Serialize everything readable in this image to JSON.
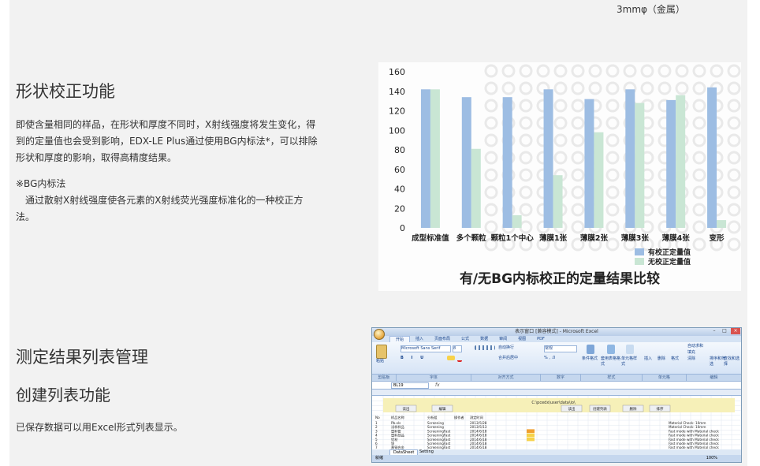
{
  "top_note": "3mmφ（金属）",
  "section1": {
    "heading": "形状校正功能",
    "para_lines": [
      "即使含量相同的样品，在形状和厚度不同时，X射线强度将发生变化，得",
      "到的定量值也会受到影响，EDX-LE Plus通过使用BG内标法*，可以排除",
      "形状和厚度的影响，取得高精度结果。"
    ],
    "note_title": "※BG内标法",
    "note_lines": [
      "　通过散射X射线强度使各元素的X射线荧光强度标准化的一种校正方",
      "法。"
    ]
  },
  "section2": {
    "heading": "测定结果列表管理",
    "subheading": "创建列表功能",
    "para": "已保存数据可以用Excel形式列表显示。"
  },
  "chart_data": {
    "type": "bar",
    "title": "有/无BG内标校正的定量结果比较",
    "categories": [
      "成型标准值",
      "多个颗粒",
      "颗粒1个中心",
      "薄膜1张",
      "薄膜2张",
      "薄膜3张",
      "薄膜4张",
      "变形"
    ],
    "series": [
      {
        "name": "有校正定量值",
        "color": "#9dbde3",
        "values": [
          142,
          134,
          134,
          142,
          132,
          142,
          131,
          144
        ]
      },
      {
        "name": "无校正定量值",
        "color": "#c9e6d4",
        "values": [
          142,
          81,
          13,
          54,
          98,
          128,
          136,
          8
        ]
      }
    ],
    "ylim": [
      0,
      160
    ],
    "yticks": [
      0,
      20,
      40,
      60,
      80,
      100,
      120,
      140,
      160
    ],
    "legend": "bottom-right",
    "grid": false
  },
  "excel": {
    "title": "表示窗口 [兼容模式] - Microsoft Excel",
    "tabs": [
      "开始",
      "插入",
      "页面布局",
      "公式",
      "数据",
      "审阅",
      "视图",
      "PDF"
    ],
    "ribbon": {
      "paste": "粘贴",
      "font_name": "Microsoft Sans Serif",
      "font_size": "8",
      "wrap": "自动换行",
      "merge": "合并后居中",
      "number_format": "常规",
      "cond_format": "条件格式",
      "table_format": "套用表格格式",
      "cell_style": "单元格样式",
      "insert": "插入",
      "delete": "删除",
      "format": "格式",
      "autosum": "自动求和",
      "fill": "填充",
      "clear": "清除",
      "sort_filter": "排序和筛选",
      "find_select": "查找和选择"
    },
    "groups": [
      "剪贴板",
      "字体",
      "对齐方式",
      "数字",
      "样式",
      "单元格",
      "编辑"
    ],
    "name_box": "BL19",
    "fx": "fx",
    "path": "C:\\pcedx\\user\\data\\io\\",
    "buttons": [
      "读出",
      "编辑",
      "读出",
      "创建列表",
      "删除",
      "排序"
    ],
    "header_row": [
      "No",
      "样品名称",
      "分析组",
      "操作者",
      "测定时间"
    ],
    "rows": [
      [
        "1",
        "Pb.xls",
        "Screening",
        "",
        "2013/5/28"
      ],
      [
        "2",
        "试样样品",
        "Screening",
        "",
        "2013/5/13"
      ],
      [
        "3",
        "塑料管",
        "ScreeningFast",
        "",
        "2014/6/18"
      ],
      [
        "4",
        "塑料部品",
        "ScreeningFast",
        "",
        "2014/6/18"
      ],
      [
        "5",
        "铝材",
        "ScreeningFast",
        "",
        "2014/6/18"
      ],
      [
        "6",
        "锌",
        "ScreeningFast",
        "",
        "2014/6/18"
      ],
      [
        "7",
        "黄铜合金",
        "ScreeningFast",
        "",
        "2014/6/18"
      ],
      [
        "8",
        "黄铜箔",
        "ScreeningFast",
        "",
        "2014/6/18"
      ]
    ],
    "remarks": [
      "Material Check: 10mm",
      "Material Check: 10mm",
      "Fast mode with Material check",
      "Fast mode with Material check",
      "Fast mode with Material check",
      "Fast mode with Material check",
      "Fast mode with Material check",
      "Fast mode with Material check"
    ],
    "sheet_tabs": [
      "DataSheet",
      "Setting"
    ],
    "status": "就绪",
    "zoom": "100%"
  }
}
